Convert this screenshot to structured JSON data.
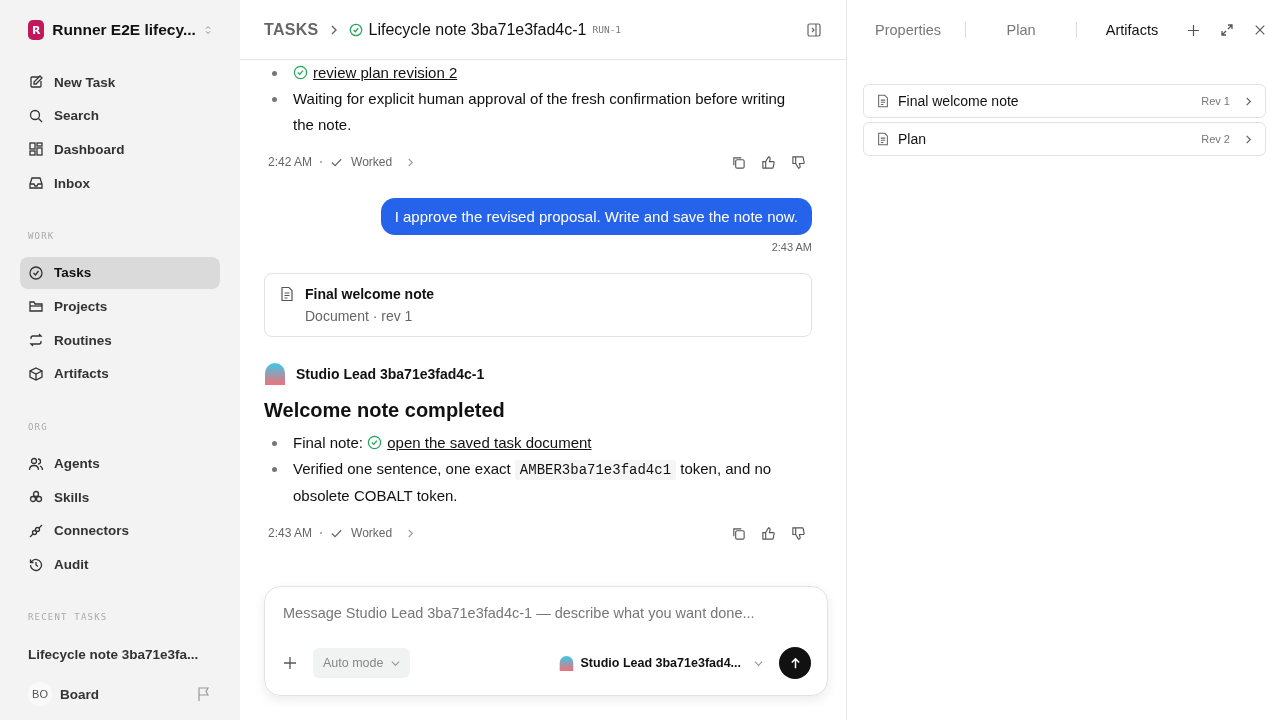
{
  "workspace": {
    "initial": "R",
    "name": "Runner E2E lifecy..."
  },
  "nav": [
    {
      "label": "New Task",
      "selected": false
    },
    {
      "label": "Search",
      "selected": false
    },
    {
      "label": "Dashboard",
      "selected": false
    },
    {
      "label": "Inbox",
      "selected": false
    }
  ],
  "work": {
    "heading": "WORK",
    "items": [
      {
        "label": "Tasks",
        "selected": true
      },
      {
        "label": "Projects",
        "selected": false
      },
      {
        "label": "Routines",
        "selected": false
      },
      {
        "label": "Artifacts",
        "selected": false
      }
    ]
  },
  "org": {
    "heading": "ORG",
    "items": [
      {
        "label": "Agents",
        "selected": false
      },
      {
        "label": "Skills",
        "selected": false
      },
      {
        "label": "Connectors",
        "selected": false
      },
      {
        "label": "Audit",
        "selected": false
      }
    ]
  },
  "recent": {
    "heading": "RECENT TASKS",
    "items": [
      {
        "label": "Lifecycle note 3ba71e3fa...",
        "selected": false
      }
    ]
  },
  "user": {
    "initials": "BO",
    "name": "Board"
  },
  "header": {
    "breadcrumb": "TASKS",
    "title": "Lifecycle note 3ba71e3fad4c-1",
    "run": "RUN-1"
  },
  "messages": [
    {
      "kind": "agent_tail",
      "bullets": [
        [
          {
            "kind": "link",
            "text": "review plan revision 2"
          }
        ],
        [
          {
            "kind": "text",
            "text": "Waiting for explicit human approval of the fresh confirmation before writing the note."
          }
        ]
      ],
      "time": "2:42 AM",
      "status": "Worked"
    },
    {
      "kind": "user",
      "text": "I approve the revised proposal. Write and save the note now.",
      "time": "2:43 AM"
    },
    {
      "kind": "artifact",
      "title": "Final welcome note",
      "subtitle": "Document · rev 1"
    },
    {
      "kind": "agent",
      "author": "Studio Lead 3ba71e3fad4c-1",
      "heading": "Welcome note completed",
      "bullets": [
        [
          {
            "kind": "text",
            "text": "Final note: "
          },
          {
            "kind": "link",
            "text": "open the saved task document"
          }
        ],
        [
          {
            "kind": "text",
            "text": "Verified one sentence, one exact "
          },
          {
            "kind": "code",
            "text": "AMBER3ba71e3fad4c1"
          },
          {
            "kind": "text",
            "text": " token, and no obsolete COBALT token."
          }
        ]
      ],
      "time": "2:43 AM",
      "status": "Worked"
    }
  ],
  "composer": {
    "placeholder": "Message Studio Lead 3ba71e3fad4c-1 — describe what you want done...",
    "mode": "Auto mode",
    "agent": "Studio Lead 3ba71e3fad4..."
  },
  "panel": {
    "tabs": [
      {
        "label": "Properties",
        "selected": false
      },
      {
        "label": "Plan",
        "selected": false
      },
      {
        "label": "Artifacts",
        "selected": true
      }
    ],
    "artifacts": [
      {
        "title": "Final welcome note",
        "rev": "Rev 1"
      },
      {
        "title": "Plan",
        "rev": "Rev 2"
      }
    ]
  }
}
